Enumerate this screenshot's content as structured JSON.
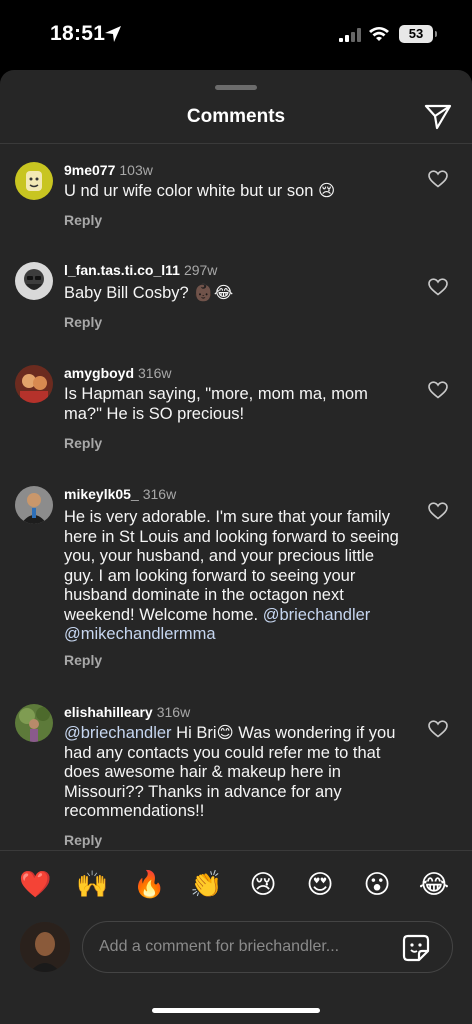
{
  "status": {
    "time": "18:51",
    "battery": "53"
  },
  "sheet": {
    "title": "Comments"
  },
  "comments": [
    {
      "username": "9me077",
      "time": "103w",
      "text": "U nd ur wife color white but ur son 😢",
      "reply": "Reply"
    },
    {
      "username": "l_fan.tas.ti.co_l11",
      "time": "297w",
      "text": "Baby Bill Cosby? 👶🏿😂",
      "reply": "Reply"
    },
    {
      "username": "amygboyd",
      "time": "316w",
      "text": "Is Hapman saying, \"more, mom ma, mom ma?\" He is SO precious!",
      "reply": "Reply"
    },
    {
      "username": "mikeylk05_",
      "time": "316w",
      "text": "He is very adorable. I'm sure that your family here in St Louis and looking forward to seeing you, your husband, and your precious little guy. I am looking forward to seeing your husband dominate in the octagon next weekend! Welcome home.",
      "mention1": "@briechandler",
      "mention2": "@mikechandlermma",
      "reply": "Reply"
    },
    {
      "username": "elishahilleary",
      "time": "316w",
      "mention": "@briechandler",
      "text": " Hi Bri😊  Was wondering if you had any contacts you could refer me to that does awesome hair & makeup here in Missouri?? Thanks in advance for any recommendations!!",
      "reply": "Reply"
    }
  ],
  "emojis": [
    "❤️",
    "🙌",
    "🔥",
    "👏",
    "😢",
    "😍",
    "😮",
    "😂"
  ],
  "composer": {
    "placeholder": "Add a comment for briechandler..."
  },
  "icons": {
    "location": "location-arrow-icon",
    "signal": "cellular-signal-icon",
    "wifi": "wifi-icon",
    "share": "paper-plane-icon",
    "like": "heart-outline-icon",
    "sticker": "sticker-icon"
  },
  "colors": {
    "sheet": "#262626",
    "mention": "#c6d6f0",
    "secondary": "#a8a8a8"
  }
}
